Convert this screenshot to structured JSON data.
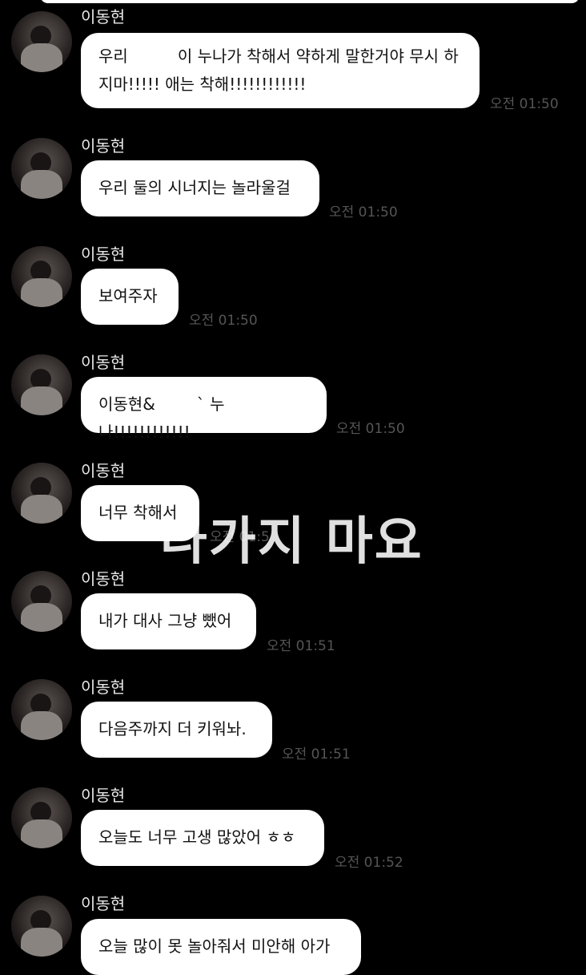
{
  "sender_name": "이동현",
  "messages": [
    {
      "line1_a": "우리",
      "line1_b": "이 누나가 착해서 약하게 말한거야 무시 하",
      "line2": "지마!!!!! 애는 착해!!!!!!!!!!!!",
      "time": "오전 01:50"
    },
    {
      "text": "우리 둘의 시너지는 놀라울걸",
      "time": "오전 01:50"
    },
    {
      "text": "보여주자",
      "time": "오전 01:50"
    },
    {
      "text_a": "이동현&",
      "text_b": "` 누나!!!!!!!!!!!!",
      "time": "오전 01:50"
    },
    {
      "text": "너무 착해서",
      "time": "오전 01:5"
    },
    {
      "text": "내가 대사 그냥 뺐어",
      "time": "오전 01:51"
    },
    {
      "text": "다음주까지 더 키워놔.",
      "time": "오전 01:51"
    },
    {
      "text": "오늘도 너무 고생 많았어 ㅎㅎ",
      "time": "오전 01:52"
    },
    {
      "text": "오늘 많이 못 놀아줘서 미안해 아가"
    }
  ],
  "overlay_text": "나가지 마요"
}
